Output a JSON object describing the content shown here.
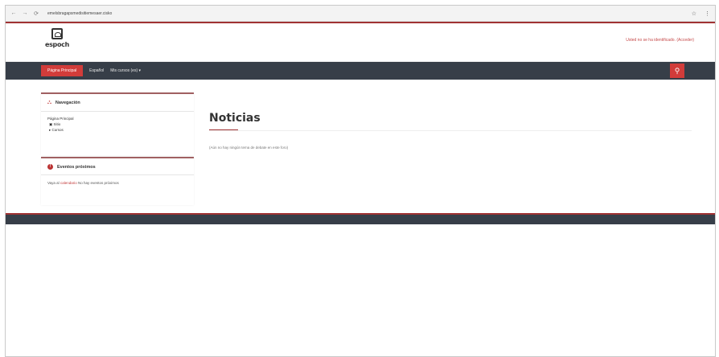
{
  "browser": {
    "url": "emelsbragapsmedisitiemesaer.cisko",
    "back": "←",
    "forward": "→",
    "reload": "⟳"
  },
  "header": {
    "logo_text": "espoch",
    "login_link": "Usted no se ha identificado. (Acceder)"
  },
  "nav": {
    "home": "Página Principal",
    "item1": "Español",
    "item2": "Mis cursos (es) ▾"
  },
  "sidebar": {
    "navigation": {
      "title": "Navegación",
      "items": [
        "Página Principal",
        "Sitio",
        "Cursos"
      ]
    },
    "events": {
      "title": "Eventos próximos",
      "text_prefix": "Vaya al ",
      "text_link": "calendario",
      "text_suffix": " No hay eventos próximos"
    }
  },
  "main": {
    "title": "Noticias",
    "empty_text": "(Aún no hay ningún tema de debate en este foro)"
  },
  "colors": {
    "accent": "#a03233",
    "nav_bg": "#373e48",
    "red": "#d23c3a"
  }
}
